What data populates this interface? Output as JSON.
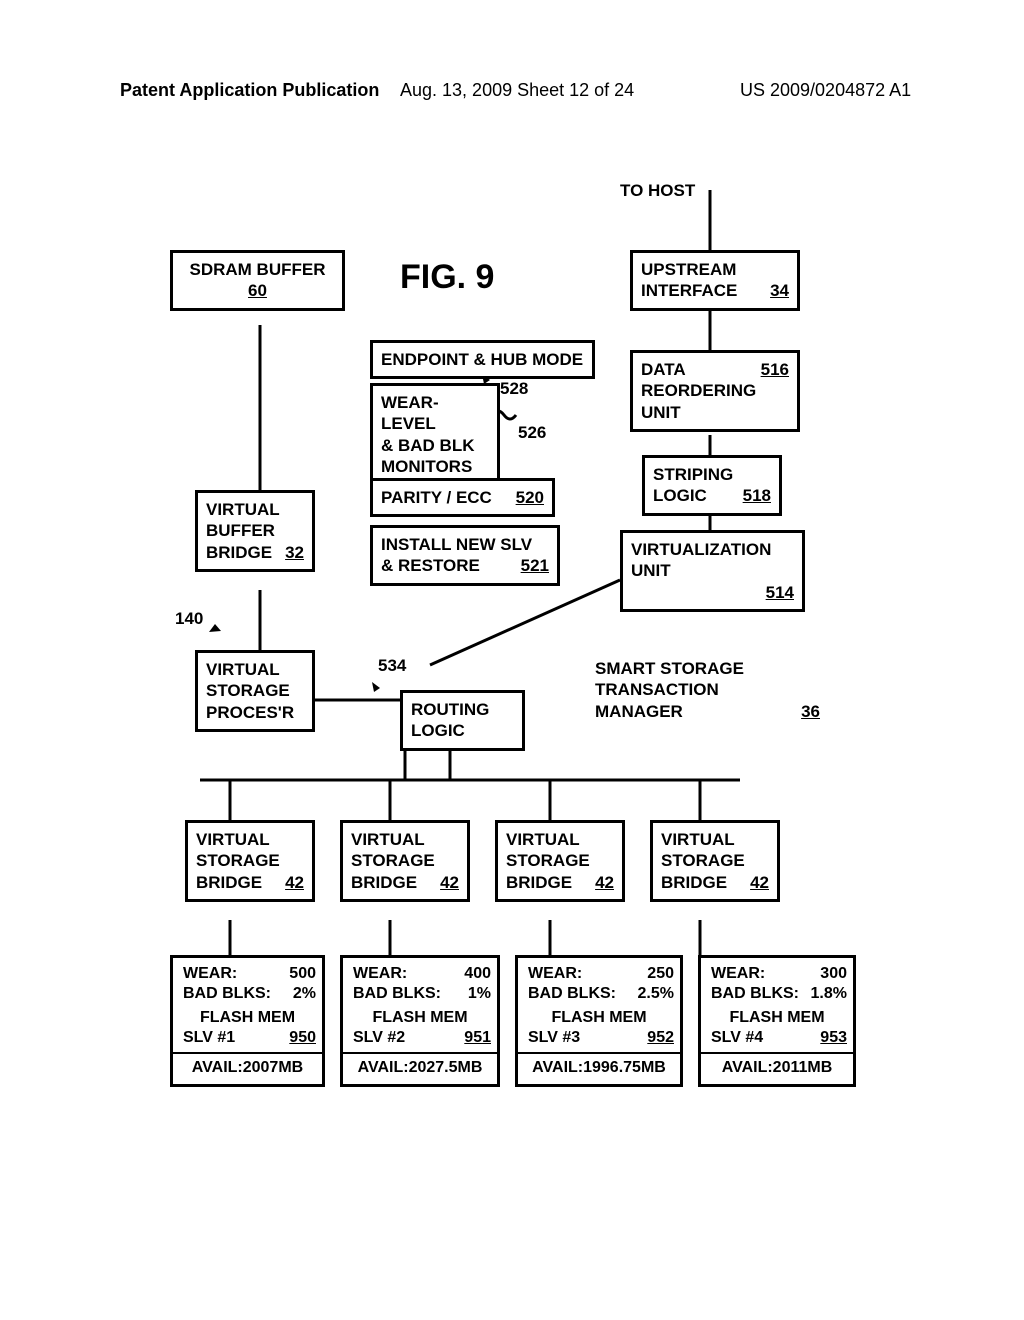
{
  "header": {
    "left": "Patent Application Publication",
    "mid": "Aug. 13, 2009  Sheet 12 of 24",
    "right": "US 2009/0204872 A1"
  },
  "fig_title": "FIG. 9",
  "to_host": "TO HOST",
  "sdram_buf": {
    "l1": "SDRAM BUFFER",
    "ref": "60"
  },
  "upstream": {
    "l1": "UPSTREAM",
    "l2": "INTERFACE",
    "ref": "34"
  },
  "endpoint": {
    "text": "ENDPOINT & HUB MODE"
  },
  "ref528": "528",
  "wear_monitors": {
    "l1": "WEAR-LEVEL",
    "l2": "& BAD BLK",
    "l3": "MONITORS"
  },
  "ref526": "526",
  "parity": {
    "text": "PARITY / ECC",
    "ref": "520"
  },
  "install": {
    "l1": "INSTALL NEW SLV",
    "l2": "& RESTORE",
    "ref": "521"
  },
  "data_reorder": {
    "l1": "DATA",
    "l2": "REORDERING",
    "l3": "UNIT",
    "ref": "516"
  },
  "striping": {
    "l1": "STRIPING",
    "l2": "LOGIC",
    "ref": "518"
  },
  "virtunit": {
    "l1": "VIRTUALIZATION",
    "l2": "UNIT",
    "ref": "514"
  },
  "vb_bridge": {
    "l1": "VIRTUAL",
    "l2": "BUFFER",
    "l3": "BRIDGE",
    "ref": "32"
  },
  "ref140": "140",
  "vsp": {
    "l1": "VIRTUAL",
    "l2": "STORAGE",
    "l3": "PROCES'R"
  },
  "ref534": "534",
  "routing": {
    "l1": "ROUTING",
    "l2": "LOGIC"
  },
  "sstm": {
    "l1": "SMART STORAGE",
    "l2": "TRANSACTION",
    "l3": "MANAGER",
    "ref": "36"
  },
  "bridges": {
    "b1": {
      "l1": "VIRTUAL",
      "l2": "STORAGE",
      "l3": "BRIDGE",
      "ref": "42"
    },
    "b2": {
      "l1": "VIRTUAL",
      "l2": "STORAGE",
      "l3": "BRIDGE",
      "ref": "42"
    },
    "b3": {
      "l1": "VIRTUAL",
      "l2": "STORAGE",
      "l3": "BRIDGE",
      "ref": "42"
    },
    "b4": {
      "l1": "VIRTUAL",
      "l2": "STORAGE",
      "l3": "BRIDGE",
      "ref": "42"
    }
  },
  "slaves": {
    "s1": {
      "wear_l": "WEAR:",
      "wear_v": "500",
      "bb_l": "BAD BLKS:",
      "bb_v": "2%",
      "name1": "FLASH MEM",
      "name2": "SLV #1",
      "ref": "950",
      "avail": "AVAIL:2007MB"
    },
    "s2": {
      "wear_l": "WEAR:",
      "wear_v": "400",
      "bb_l": "BAD BLKS:",
      "bb_v": "1%",
      "name1": "FLASH MEM",
      "name2": "SLV #2",
      "ref": "951",
      "avail": "AVAIL:2027.5MB"
    },
    "s3": {
      "wear_l": "WEAR:",
      "wear_v": "250",
      "bb_l": "BAD BLKS:",
      "bb_v": "2.5%",
      "name1": "FLASH MEM",
      "name2": "SLV #3",
      "ref": "952",
      "avail": "AVAIL:1996.75MB"
    },
    "s4": {
      "wear_l": "WEAR:",
      "wear_v": "300",
      "bb_l": "BAD BLKS:",
      "bb_v": "1.8%",
      "name1": "FLASH MEM",
      "name2": "SLV #4",
      "ref": "953",
      "avail": "AVAIL:2011MB"
    }
  },
  "chart_data": {
    "type": "table",
    "title": "Flash memory slave statistics (FIG. 9)",
    "columns": [
      "slave",
      "wear",
      "bad_blocks_pct",
      "available_mb",
      "ref"
    ],
    "rows": [
      [
        "SLV #1",
        500,
        2.0,
        2007.0,
        950
      ],
      [
        "SLV #2",
        400,
        1.0,
        2027.5,
        951
      ],
      [
        "SLV #3",
        250,
        2.5,
        1996.75,
        952
      ],
      [
        "SLV #4",
        300,
        1.8,
        2011.0,
        953
      ]
    ]
  }
}
